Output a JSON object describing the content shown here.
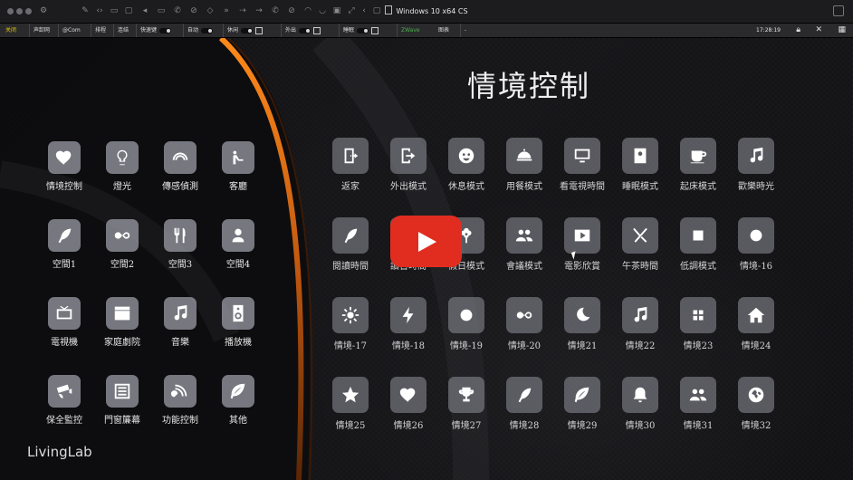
{
  "window": {
    "title": "Windows 10 x64 CS"
  },
  "toolbar": {
    "items": [
      {
        "label": "关闭",
        "color": "#e6c800"
      },
      {
        "label": "声卸网"
      },
      {
        "label": "@Com"
      },
      {
        "label": "排程"
      },
      {
        "label": "连结"
      },
      {
        "label": "快速键"
      },
      {
        "label": "自动"
      },
      {
        "label": "休闲"
      },
      {
        "label": "外出"
      },
      {
        "label": "睡眠"
      },
      {
        "label": "ZWave"
      },
      {
        "label": "图表"
      },
      {
        "label": "-"
      }
    ],
    "clock": "17:28:19"
  },
  "page": {
    "title": "情境控制",
    "logo": "LivingLab"
  },
  "left_menu": [
    {
      "label": "情境控制",
      "icon": "heart-icon"
    },
    {
      "label": "燈光",
      "icon": "bulb-icon"
    },
    {
      "label": "傳感偵測",
      "icon": "signal-icon"
    },
    {
      "label": "客廳",
      "icon": "sofa-icon"
    },
    {
      "label": "空間1",
      "icon": "feather-icon"
    },
    {
      "label": "空間2",
      "icon": "infinity-icon"
    },
    {
      "label": "空間3",
      "icon": "dining-icon"
    },
    {
      "label": "空間4",
      "icon": "person-icon"
    },
    {
      "label": "電視機",
      "icon": "tv-icon"
    },
    {
      "label": "家庭劇院",
      "icon": "clapper-icon"
    },
    {
      "label": "音樂",
      "icon": "music-icon"
    },
    {
      "label": "播放機",
      "icon": "speaker-icon"
    },
    {
      "label": "保全監控",
      "icon": "camera-icon"
    },
    {
      "label": "門窗簾幕",
      "icon": "curtain-icon"
    },
    {
      "label": "功能控制",
      "icon": "satellite-icon"
    },
    {
      "label": "其他",
      "icon": "leaf-icon"
    }
  ],
  "scenes": [
    {
      "label": "返家",
      "icon": "door-icon"
    },
    {
      "label": "外出模式",
      "icon": "exit-icon"
    },
    {
      "label": "休息模式",
      "icon": "face-icon"
    },
    {
      "label": "用餐模式",
      "icon": "dish-icon"
    },
    {
      "label": "看電視時間",
      "icon": "monitor-icon"
    },
    {
      "label": "睡眠模式",
      "icon": "contact-icon"
    },
    {
      "label": "起床模式",
      "icon": "cup-icon"
    },
    {
      "label": "歡樂時光",
      "icon": "music-icon"
    },
    {
      "label": "閱讀時間",
      "icon": "feather-icon"
    },
    {
      "label": "讀書時間",
      "icon": "book-icon"
    },
    {
      "label": "假日模式",
      "icon": "flower-icon"
    },
    {
      "label": "會議模式",
      "icon": "group-icon"
    },
    {
      "label": "電影欣賞",
      "icon": "play-icon"
    },
    {
      "label": "午茶時間",
      "icon": "cutlery-icon"
    },
    {
      "label": "低調模式",
      "icon": "square-icon"
    },
    {
      "label": "情境-16",
      "icon": "circle-icon"
    },
    {
      "label": "情境-17",
      "icon": "sun-icon"
    },
    {
      "label": "情境-18",
      "icon": "bolt-icon"
    },
    {
      "label": "情境-19",
      "icon": "circle-icon"
    },
    {
      "label": "情境-20",
      "icon": "infinity-icon"
    },
    {
      "label": "情境21",
      "icon": "moon-icon"
    },
    {
      "label": "情境22",
      "icon": "music-icon"
    },
    {
      "label": "情境23",
      "icon": "grid-icon"
    },
    {
      "label": "情境24",
      "icon": "home-icon"
    },
    {
      "label": "情境25",
      "icon": "star-icon"
    },
    {
      "label": "情境26",
      "icon": "heart-icon"
    },
    {
      "label": "情境27",
      "icon": "trophy-icon"
    },
    {
      "label": "情境28",
      "icon": "feather-icon"
    },
    {
      "label": "情境29",
      "icon": "leaf-icon"
    },
    {
      "label": "情境30",
      "icon": "bell-icon"
    },
    {
      "label": "情境31",
      "icon": "group-icon"
    },
    {
      "label": "情境32",
      "icon": "globe-icon"
    }
  ],
  "video_overlay": {
    "icon": "youtube-play-icon",
    "color": "#e12d20"
  }
}
